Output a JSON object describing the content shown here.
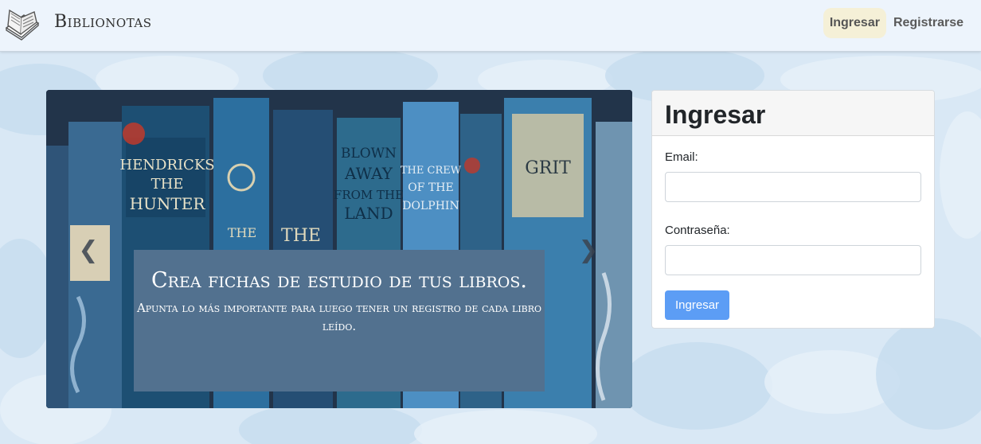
{
  "brand": {
    "name": "Biblionotas",
    "icon": "open-book-icon"
  },
  "nav": {
    "login_label": "Ingresar",
    "register_label": "Registrarse"
  },
  "carousel": {
    "prev_icon": "chevron-left-icon",
    "next_icon": "chevron-right-icon",
    "caption_title": "Crea fichas de estudio de tus libros.",
    "caption_subtitle": "Apunta lo más importante para luego tener un registro de cada libro leído.",
    "spine_texts": [
      "HENDRICKS THE HUNTER",
      "THE",
      "THE",
      "BLOWN AWAY FROM THE LAND",
      "THE CREW OF THE DOLPHIN",
      "GRIT"
    ]
  },
  "login_form": {
    "title": "Ingresar",
    "email_label": "Email:",
    "email_value": "",
    "password_label": "Contraseña:",
    "password_value": "",
    "submit_label": "Ingresar"
  },
  "colors": {
    "navbar_bg": "#edf4fc",
    "page_bg": "#d9e8f5",
    "caption_bg": "#52718f",
    "primary_button": "#5c9df5",
    "active_nav_bg": "#f5f0d7"
  }
}
